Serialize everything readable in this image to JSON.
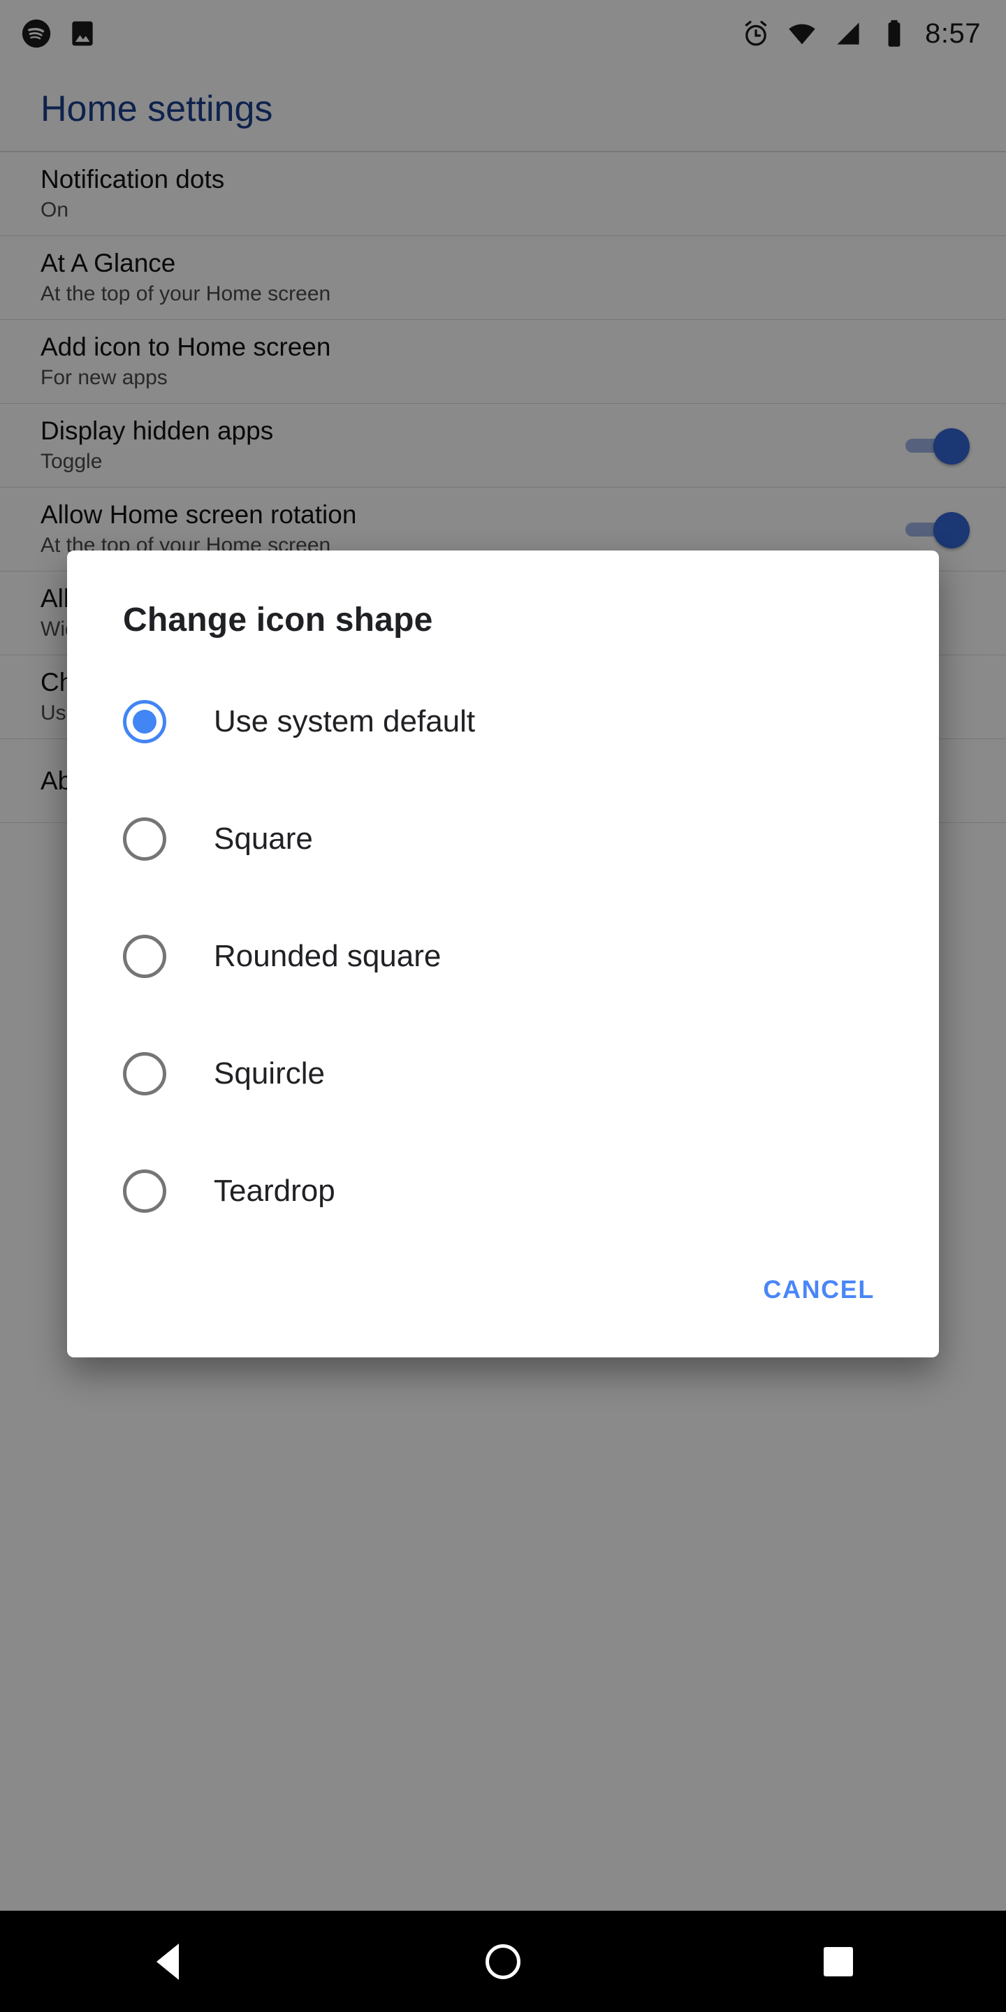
{
  "statusbar": {
    "time": "8:57",
    "left_icons": [
      "spotify-icon",
      "photos-icon"
    ],
    "right_icons": [
      "alarm-icon",
      "wifi-icon",
      "cell-signal-icon",
      "battery-icon"
    ]
  },
  "page": {
    "title": "Home settings",
    "rows": [
      {
        "title": "Notification dots",
        "subtitle": "On",
        "toggle": false
      },
      {
        "title": "At A Glance",
        "subtitle": "At the top of your Home screen",
        "toggle": false
      },
      {
        "title": "Add icon to Home screen",
        "subtitle": "For new apps",
        "toggle": false
      },
      {
        "title": "Display hidden apps",
        "subtitle": "Toggle",
        "toggle": true
      },
      {
        "title": "Allow Home screen rotation",
        "subtitle": "At the top of your Home screen",
        "toggle": true
      },
      {
        "title": "Allow app widgets",
        "subtitle": "Widgets on Home screen",
        "toggle": false
      },
      {
        "title": "Change icon shape",
        "subtitle": "Use system default",
        "toggle": false
      },
      {
        "title": "About",
        "subtitle": "",
        "toggle": false
      }
    ]
  },
  "dialog": {
    "title": "Change icon shape",
    "options": [
      {
        "label": "Use system default",
        "selected": true
      },
      {
        "label": "Square",
        "selected": false
      },
      {
        "label": "Rounded square",
        "selected": false
      },
      {
        "label": "Squircle",
        "selected": false
      },
      {
        "label": "Teardrop",
        "selected": false
      }
    ],
    "cancel_label": "CANCEL"
  },
  "navbar": {
    "back_label": "Back",
    "home_label": "Home",
    "recents_label": "Recents"
  },
  "colors": {
    "accent": "#4285f4",
    "title": "#1b3f8f",
    "cancel": "#4a86f7",
    "toggle_on": "#3367d6"
  }
}
